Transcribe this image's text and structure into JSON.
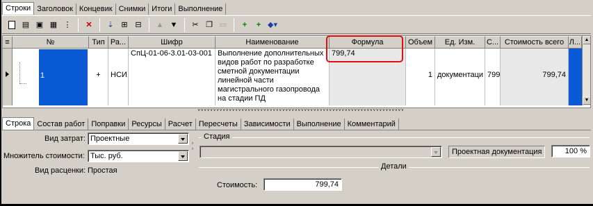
{
  "top_tabs": [
    "Строки",
    "Заголовок",
    "Концевик",
    "Снимки",
    "Итоги",
    "Выполнение"
  ],
  "toolbar": {
    "icons": [
      "new-doc-icon",
      "book-icon",
      "save-icon",
      "print-icon",
      "tree-icon",
      "delete-icon",
      "import-icon",
      "copy-rows-icon",
      "paste-rows-icon",
      "arrow-up-icon",
      "arrow-down-icon",
      "cut-icon",
      "copy-icon",
      "paste-icon",
      "add-plus-icon",
      "add-sub-icon",
      "fill-dropdown-icon"
    ]
  },
  "grid": {
    "columns": {
      "no": "№",
      "type": "Тип",
      "section": "Ра...",
      "code": "Шифр",
      "name": "Наименование",
      "formula": "Формула",
      "volume": "Объем",
      "unit": "Ед. Изм.",
      "cost_col": "С...",
      "total": "Стоимость всего",
      "extra": "Л..."
    },
    "row": {
      "no": "1",
      "type": "+",
      "section": "НСИ",
      "code": "СпЦ-01-06-3.01-03-001",
      "name": "Выполнение дополнительных видов работ по разработке сметной документации линейной части магистрального газопровода на стадии ПД",
      "formula": "799,74",
      "volume": "1",
      "unit": "документаци",
      "cost_col": "799",
      "total": "799,74"
    },
    "scroll_glyph": "˅˅˅˅˅˅˅˅˅˅˅˅˅˅˅˅˅˅˅˅˅˅˅˅˅˅˅˅˅˅˅˅˅˅˅˅˅˅˅˅˅˅˅˅˅˅˅˅˅˅˅˅˅˅˅˅˅˅˅˅˅˅˅˅˅˅"
  },
  "bottom_tabs": [
    "Строка",
    "Состав работ",
    "Поправки",
    "Ресурсы",
    "Расчет",
    "Пересчеты",
    "Зависимости",
    "Выполнение",
    "Комментарий"
  ],
  "form": {
    "cost_type_label": "Вид затрат:",
    "cost_type_value": "Проектные",
    "multiplier_label": "Множитель стоимости:",
    "multiplier_value": "Тыс. руб.",
    "pricing_label": "Вид расценки:",
    "pricing_value": "Простая",
    "stage_title": "Стадия",
    "stage_combo": "",
    "stage_doc": "Проектная документация",
    "stage_percent": "100 %",
    "details_title": "Детали",
    "cost_label": "Стоимость:",
    "cost_value": "799,74"
  },
  "colors": {
    "selection": "#0a5ad6",
    "highlight": "#e01010",
    "face": "#d4d0c8"
  }
}
